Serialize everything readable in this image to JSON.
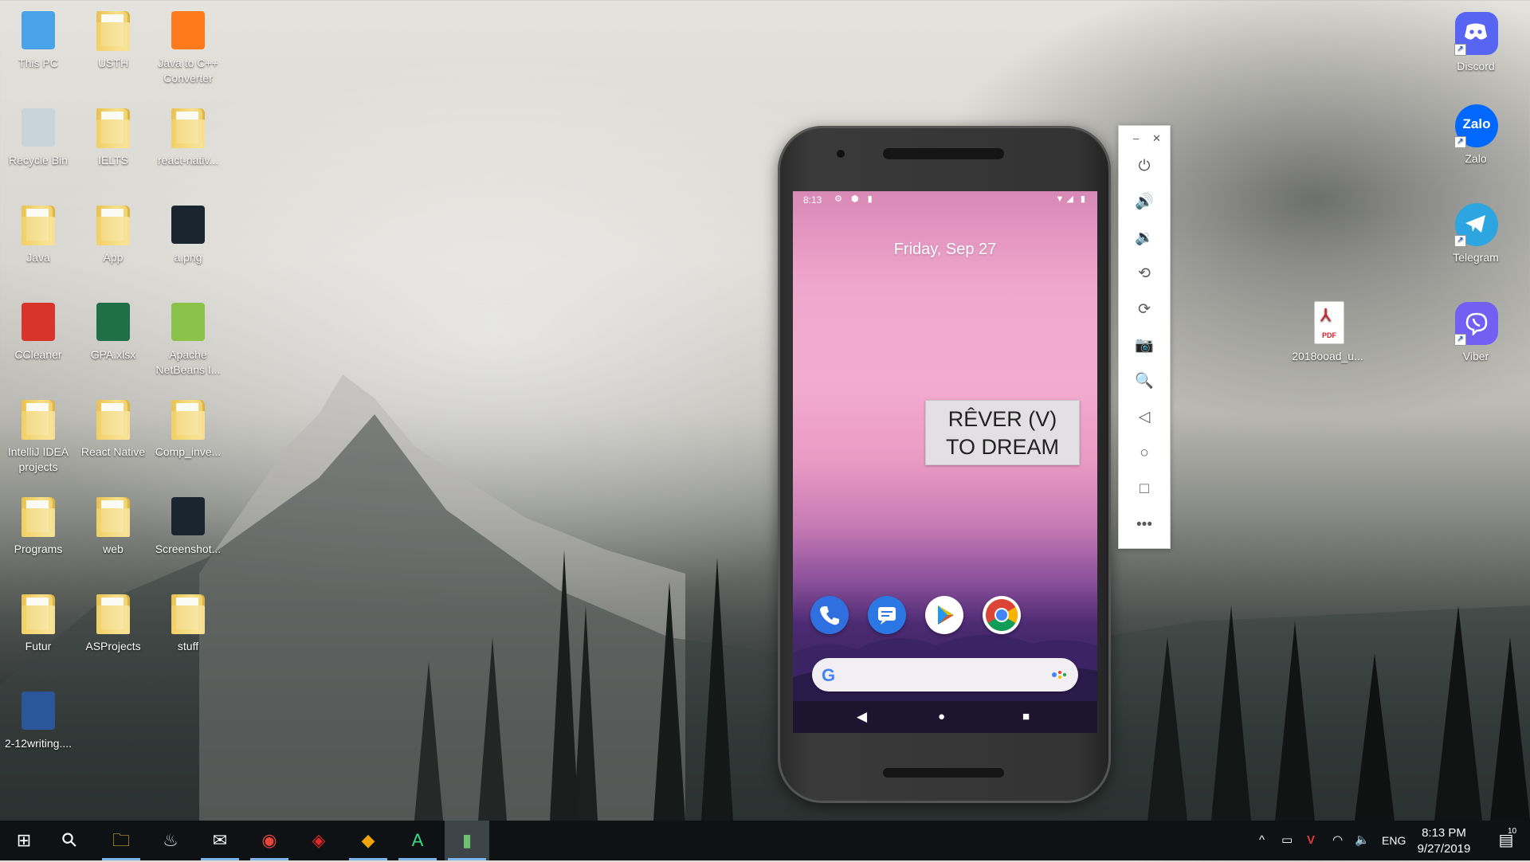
{
  "desktop": {
    "icons_left": [
      {
        "label": "This PC",
        "icon": "computer-icon"
      },
      {
        "label": "USTH",
        "icon": "folder-icon"
      },
      {
        "label": "Java to C++ Converter",
        "icon": "app-icon"
      },
      {
        "label": "Recycle Bin",
        "icon": "recycle-bin-icon"
      },
      {
        "label": "IELTS",
        "icon": "folder-icon"
      },
      {
        "label": "react-nativ...",
        "icon": "folder-icon"
      },
      {
        "label": "Java",
        "icon": "folder-icon"
      },
      {
        "label": "App",
        "icon": "folder-icon"
      },
      {
        "label": "a.png",
        "icon": "image-icon"
      },
      {
        "label": "CCleaner",
        "icon": "ccleaner-icon"
      },
      {
        "label": "GPA.xlsx",
        "icon": "excel-icon"
      },
      {
        "label": "Apache NetBeans I...",
        "icon": "netbeans-icon"
      },
      {
        "label": "IntelliJ IDEA projects",
        "icon": "folder-icon"
      },
      {
        "label": "React Native",
        "icon": "folder-icon"
      },
      {
        "label": "Comp_inve...",
        "icon": "folder-icon"
      },
      {
        "label": "Programs",
        "icon": "folder-icon"
      },
      {
        "label": "web",
        "icon": "folder-icon"
      },
      {
        "label": "Screenshot...",
        "icon": "image-icon"
      },
      {
        "label": "Futur",
        "icon": "folder-icon"
      },
      {
        "label": "ASProjects",
        "icon": "folder-icon"
      },
      {
        "label": "stuff",
        "icon": "folder-icon"
      },
      {
        "label": "2-12writing....",
        "icon": "word-icon"
      }
    ],
    "icons_right": [
      {
        "label": "Discord",
        "icon": "discord-icon"
      },
      {
        "label": "Zalo",
        "icon": "zalo-icon"
      },
      {
        "label": "Telegram",
        "icon": "telegram-icon"
      },
      {
        "label": "2018ooad_u...",
        "icon": "pdf-icon"
      },
      {
        "label": "Viber",
        "icon": "viber-icon"
      }
    ],
    "zalo_glyph": "Zalo",
    "pdf_glyph": "PDF"
  },
  "phone": {
    "status_time": "8:13",
    "date": "Friday, Sep 27",
    "widget_line1": "RÊVER (V)",
    "widget_line2": "TO DREAM",
    "dock_apps": [
      "phone-app-icon",
      "messages-app-icon",
      "play-store-icon",
      "chrome-app-icon"
    ],
    "search_logo": "G",
    "nav": {
      "back": "◀",
      "home": "●",
      "recents": "■"
    }
  },
  "emulator_toolbar": {
    "minimize": "–",
    "close": "✕",
    "buttons": [
      {
        "name": "power-icon",
        "glyph": "⏻"
      },
      {
        "name": "volume-up-icon",
        "glyph": "🔊"
      },
      {
        "name": "volume-down-icon",
        "glyph": "🔉"
      },
      {
        "name": "rotate-left-icon",
        "glyph": "⟲"
      },
      {
        "name": "rotate-right-icon",
        "glyph": "⟳"
      },
      {
        "name": "camera-icon",
        "glyph": "📷"
      },
      {
        "name": "zoom-icon",
        "glyph": "🔍"
      },
      {
        "name": "back-icon",
        "glyph": "◁"
      },
      {
        "name": "home-icon",
        "glyph": "○"
      },
      {
        "name": "overview-icon",
        "glyph": "□"
      },
      {
        "name": "more-icon",
        "glyph": "•••"
      }
    ]
  },
  "taskbar": {
    "start_glyph": "⊞",
    "search_glyph": "⚲",
    "apps": [
      {
        "name": "file-explorer-icon",
        "glyph": "🗀"
      },
      {
        "name": "steam-icon",
        "glyph": "♨"
      },
      {
        "name": "mail-icon",
        "glyph": "✉"
      },
      {
        "name": "chrome-icon",
        "glyph": "◉"
      },
      {
        "name": "garena-icon",
        "glyph": "◈"
      },
      {
        "name": "git-icon",
        "glyph": "◆"
      },
      {
        "name": "android-studio-icon",
        "glyph": "A"
      },
      {
        "name": "emulator-icon",
        "glyph": "▮"
      }
    ],
    "tray": {
      "chevron": "^",
      "battery": "▭",
      "vivaldi": "V",
      "wifi": "◠",
      "volume": "🔈",
      "language": "ENG"
    },
    "clock_time": "8:13 PM",
    "clock_date": "9/27/2019",
    "notifications_count": "10"
  },
  "colors": {
    "taskbar": "#0e1214",
    "taskbar_indicator": "#7eb4ea",
    "phone_wallpaper_pink": "#f0a7cd",
    "phone_wallpaper_purple": "#4b2a72"
  }
}
